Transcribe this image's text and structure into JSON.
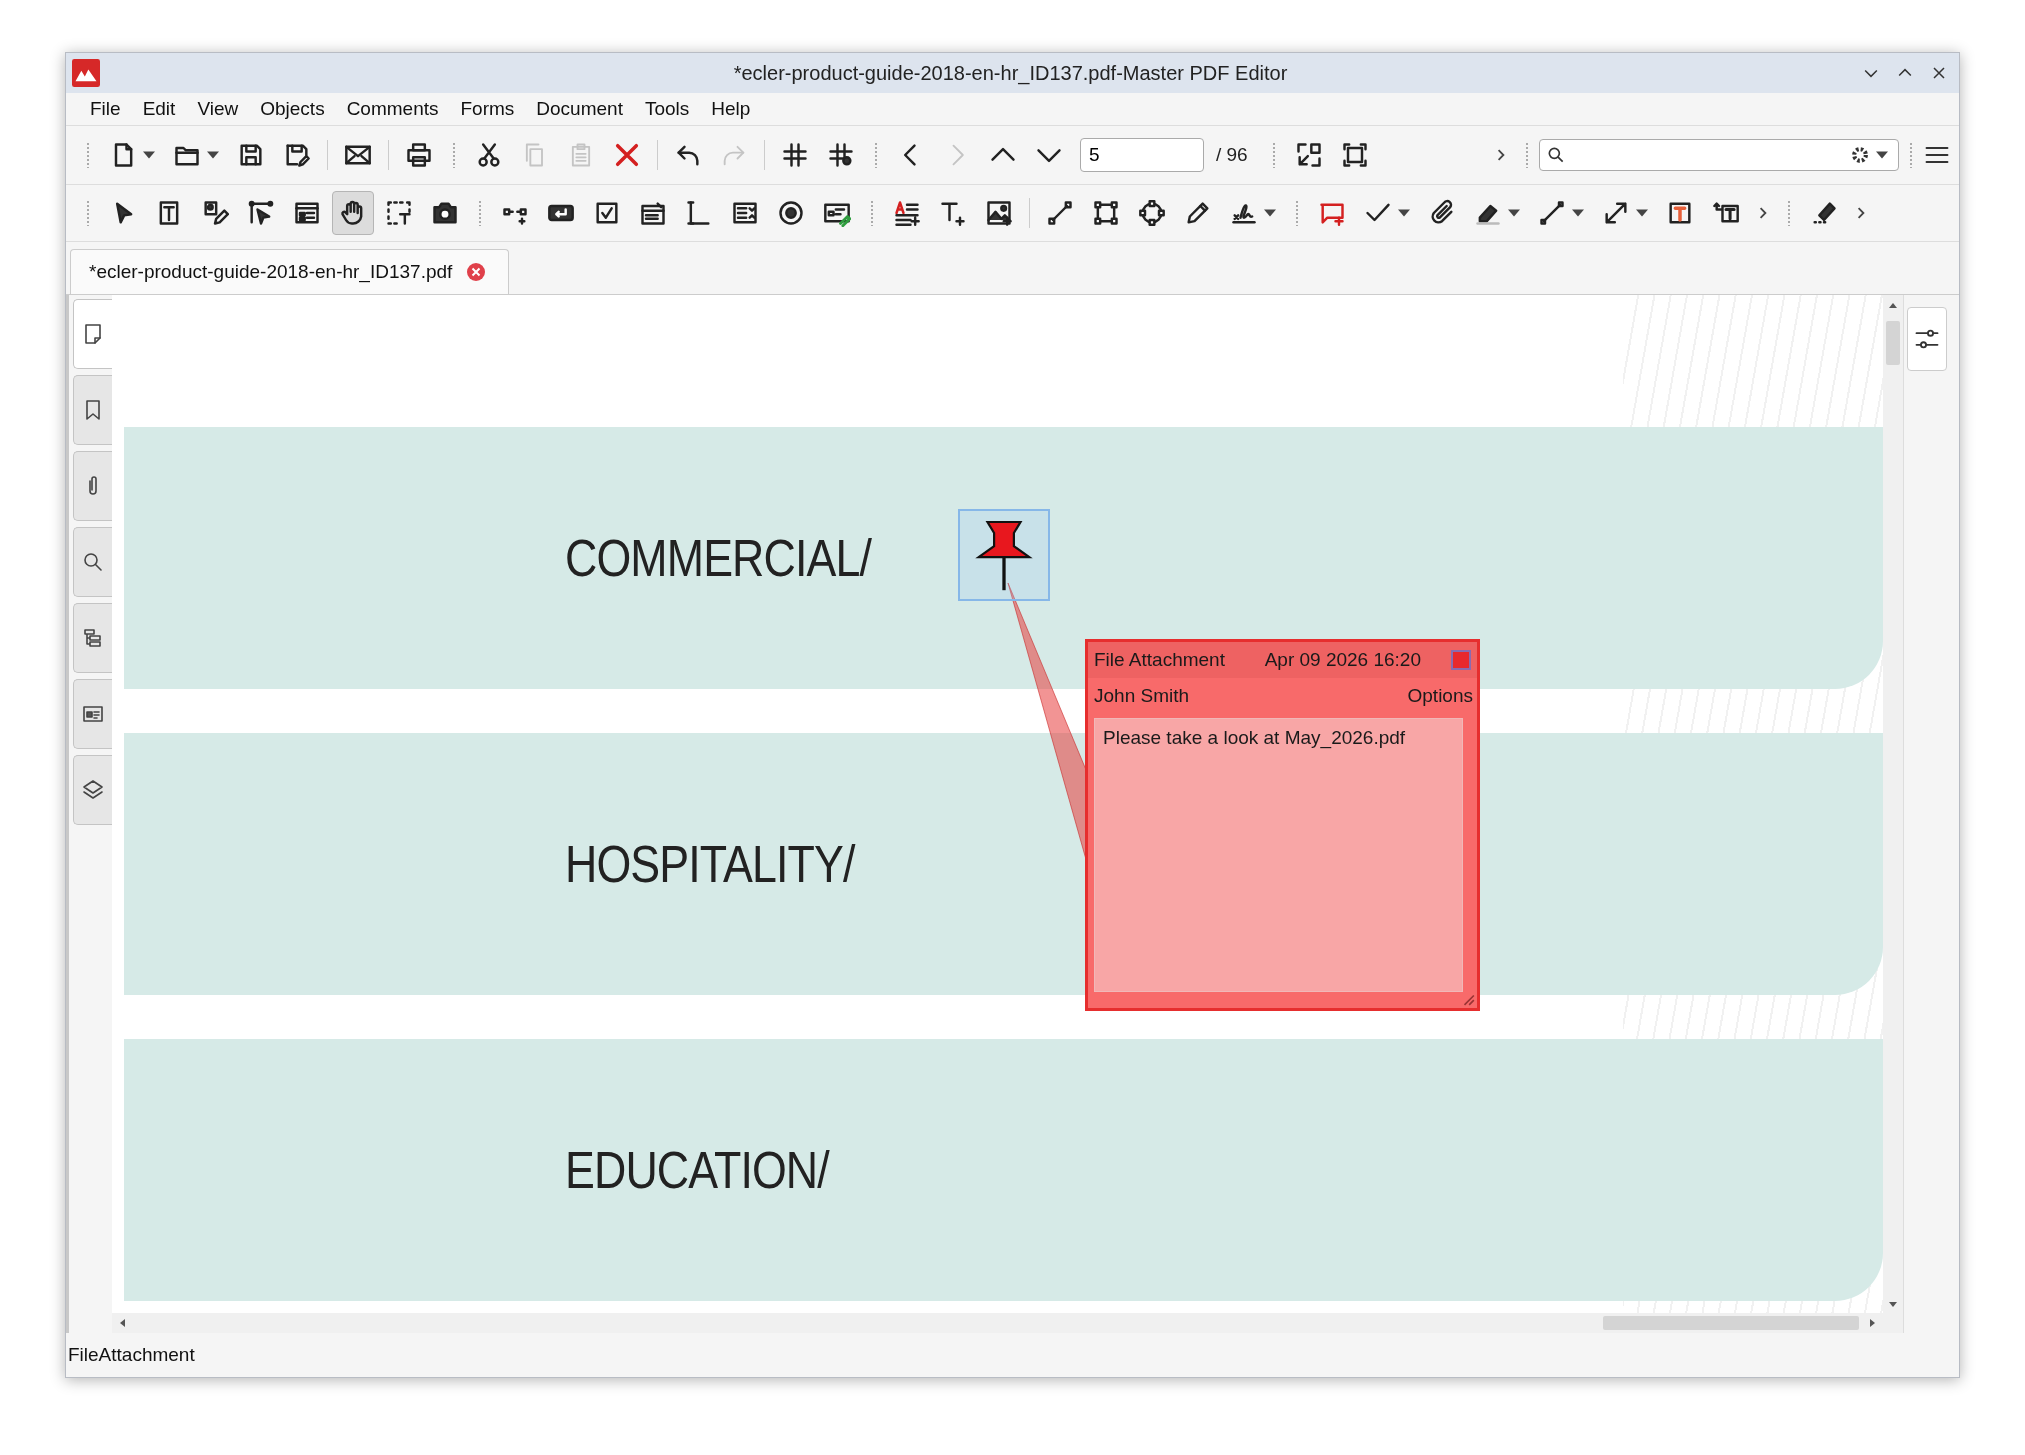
{
  "window": {
    "title": "*ecler-product-guide-2018-en-hr_ID137.pdf-Master PDF Editor"
  },
  "menu": [
    "File",
    "Edit",
    "View",
    "Objects",
    "Comments",
    "Forms",
    "Document",
    "Tools",
    "Help"
  ],
  "main_toolbar": [
    {
      "disabled": false
    },
    {
      "disabled": false
    },
    {
      "disabled": false
    },
    {
      "disabled": false
    },
    {
      "disabled": false
    },
    {
      "disabled": false
    },
    {
      "disabled": false
    },
    {
      "disabled": true
    },
    {
      "disabled": true
    },
    {
      "disabled": false
    },
    {
      "disabled": false
    },
    {
      "disabled": true
    },
    {
      "disabled": false
    },
    {
      "disabled": false
    },
    {
      "disabled": false
    },
    {
      "disabled": true
    },
    {
      "disabled": false
    },
    {
      "disabled": false
    },
    {
      "disabled": false
    },
    {
      "disabled": false
    }
  ],
  "page_field": {
    "value": "5",
    "total": "/ 96"
  },
  "tools_toolbar": [
    {
      "selected": false
    },
    {
      "selected": false
    },
    {
      "selected": false
    },
    {
      "selected": false
    },
    {
      "selected": false
    },
    {
      "selected": true
    },
    {
      "selected": false
    },
    {
      "selected": false
    },
    {
      "selected": false
    },
    {
      "selected": false
    },
    {
      "selected": false
    },
    {
      "selected": false
    },
    {
      "selected": false
    },
    {
      "selected": false
    },
    {
      "selected": false
    },
    {
      "selected": false
    },
    {
      "selected": false
    },
    {
      "selected": false
    },
    {
      "selected": false
    },
    {
      "selected": false
    },
    {
      "selected": false
    },
    {
      "selected": false
    },
    {
      "selected": false
    },
    {
      "selected": false
    },
    {
      "selected": false
    },
    {
      "selected": false
    },
    {
      "selected": false
    },
    {
      "selected": false
    },
    {
      "selected": false
    },
    {
      "selected": false
    },
    {
      "selected": false
    },
    {
      "selected": false
    },
    {
      "selected": false
    }
  ],
  "document_tab": {
    "label": "*ecler-product-guide-2018-en-hr_ID137.pdf"
  },
  "side_tabs": [
    {
      "selected": true
    },
    {
      "selected": false
    },
    {
      "selected": false
    },
    {
      "selected": false
    },
    {
      "selected": false
    },
    {
      "selected": false
    },
    {
      "selected": false
    }
  ],
  "page": {
    "sections": [
      "COMMERCIAL/",
      "HOSPITALITY/",
      "EDUCATION/"
    ]
  },
  "annotation": {
    "selected": true,
    "popup": {
      "type": "File Attachment",
      "date": "Apr 09 2026 16:20",
      "author": "John Smith",
      "options": "Options",
      "text": "Please take a look at May_2026.pdf"
    }
  },
  "status_bar": "FileAttachment"
}
